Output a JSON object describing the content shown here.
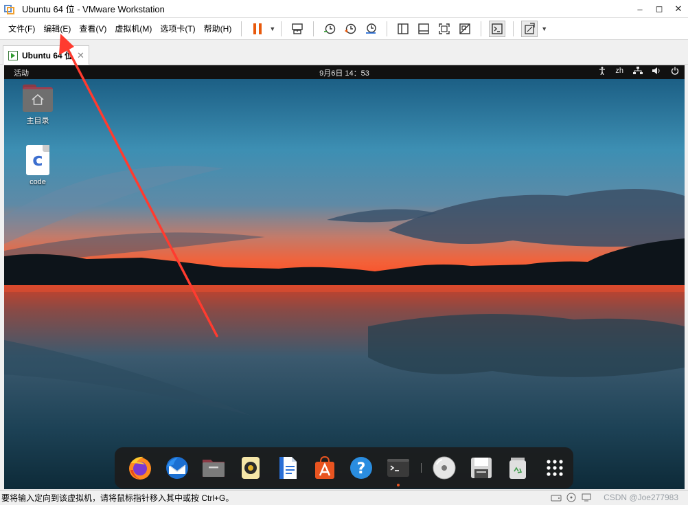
{
  "window": {
    "title": "Ubuntu 64 位 - VMware Workstation",
    "controls": {
      "minimize": "–",
      "restore": "◻",
      "close": "✕"
    }
  },
  "menu": {
    "items": [
      "文件(F)",
      "编辑(E)",
      "查看(V)",
      "虚拟机(M)",
      "选项卡(T)",
      "帮助(H)"
    ]
  },
  "toolbar": {
    "icons": [
      "pause-icon",
      "send-ctrl-alt-del-icon",
      "snapshot-take-icon",
      "snapshot-revert-icon",
      "snapshot-manager-icon",
      "show-library-icon",
      "thumbnail-bar-icon",
      "full-screen-icon",
      "unity-icon",
      "console-view-icon",
      "stretch-guest-icon"
    ],
    "accent": "#e8590c"
  },
  "tab": {
    "label": "Ubuntu 64 位",
    "close": "✕"
  },
  "guest": {
    "topbar": {
      "activities": "活动",
      "clock": "9月6日  14：53",
      "language": "zh"
    },
    "desktop_icons": [
      {
        "label": "主目录"
      },
      {
        "label": "code"
      }
    ],
    "dock": {
      "apps": [
        "firefox-icon",
        "thunderbird-icon",
        "files-icon",
        "rhythmbox-icon",
        "libreoffice-writer-icon",
        "software-center-icon",
        "help-icon",
        "terminal-icon",
        "dvd-icon",
        "floppy-save-icon",
        "trash-icon",
        "show-apps-icon"
      ]
    }
  },
  "statusbar": {
    "text": "要将输入定向到该虚拟机，请将鼠标指针移入其中或按 Ctrl+G。",
    "watermark": "CSDN @Joe277983"
  },
  "colors": {
    "annotation_arrow": "#ff3b2f",
    "ubuntu_orange": "#e95420"
  }
}
